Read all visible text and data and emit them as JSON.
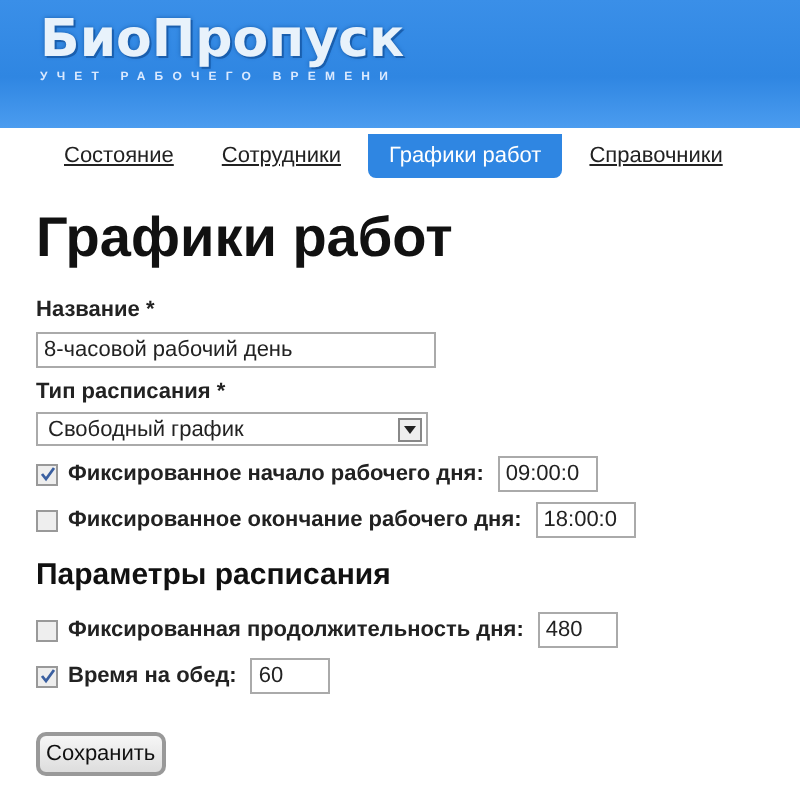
{
  "header": {
    "logo": "БиоПропуск",
    "tagline": "УЧЕТ РАБОЧЕГО ВРЕМЕНИ"
  },
  "tabs": [
    {
      "label": "Состояние",
      "selected": false
    },
    {
      "label": "Сотрудники",
      "selected": false
    },
    {
      "label": "Графики работ",
      "selected": true
    },
    {
      "label": "Справочники",
      "selected": false
    }
  ],
  "page_title": "Графики работ",
  "name_field": {
    "label": "Название *",
    "value": "8-часовой рабочий день"
  },
  "type_field": {
    "label": "Тип расписания *",
    "value": "Свободный график"
  },
  "time_options": [
    {
      "label": "Фиксированное начало рабочего дня:",
      "checked": true,
      "value": "09:00:0"
    },
    {
      "label": "Фиксированное окончание рабочего дня:",
      "checked": false,
      "value": "18:00:0"
    }
  ],
  "section_title": "Параметры расписания",
  "params": [
    {
      "label": "Фиксированная продолжительность дня:",
      "checked": false,
      "value": "480"
    },
    {
      "label": "Время на обед:",
      "checked": true,
      "value": "60"
    }
  ],
  "save_button": "Сохранить"
}
